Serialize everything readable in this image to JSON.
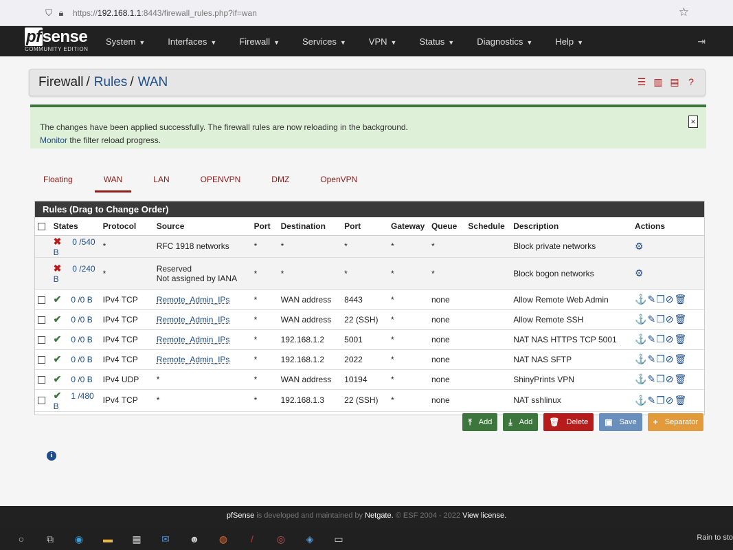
{
  "browser": {
    "url_prefix": "https://",
    "url_host": "192.168.1.1",
    "url_path": ":8443/firewall_rules.php?if=wan"
  },
  "logo": {
    "pf": "pf",
    "sense": "sense",
    "edition": "COMMUNITY EDITION"
  },
  "nav": {
    "items": [
      "System",
      "Interfaces",
      "Firewall",
      "Services",
      "VPN",
      "Status",
      "Diagnostics",
      "Help"
    ]
  },
  "title": {
    "firewall": "Firewall",
    "rules": "Rules",
    "wan": "WAN",
    "sep": "/"
  },
  "alert": {
    "message": "The changes have been applied successfully. The firewall rules are now reloading in the background.",
    "monitor": "Monitor",
    "monitor_rest": " the filter reload progress.",
    "close": "×"
  },
  "tabs": [
    "Floating",
    "WAN",
    "LAN",
    "OPENVPN",
    "DMZ",
    "OpenVPN"
  ],
  "panel": {
    "title": "Rules (Drag to Change Order)",
    "columns": [
      "",
      "States",
      "Protocol",
      "Source",
      "Port",
      "Destination",
      "Port",
      "Gateway",
      "Queue",
      "Schedule",
      "Description",
      "Actions"
    ]
  },
  "system_rules": [
    {
      "states": "0 /540 B",
      "protocol": "*",
      "source": "RFC 1918 networks",
      "source2": "",
      "port": "*",
      "destination": "*",
      "dport": "*",
      "gateway": "*",
      "queue": "*",
      "schedule": "",
      "description": "Block private networks"
    },
    {
      "states": "0 /240 B",
      "protocol": "*",
      "source": "Reserved",
      "source2": "Not assigned by IANA",
      "port": "*",
      "destination": "*",
      "dport": "*",
      "gateway": "*",
      "queue": "*",
      "schedule": "",
      "description": "Block bogon networks"
    }
  ],
  "rules": [
    {
      "states": "0 /0 B",
      "protocol": "IPv4 TCP",
      "source": "Remote_Admin_IPs",
      "port": "*",
      "destination": "WAN address",
      "dport": "8443",
      "gateway": "*",
      "queue": "none",
      "schedule": "",
      "description": "Allow Remote Web Admin"
    },
    {
      "states": "0 /0 B",
      "protocol": "IPv4 TCP",
      "source": "Remote_Admin_IPs",
      "port": "*",
      "destination": "WAN address",
      "dport": "22 (SSH)",
      "gateway": "*",
      "queue": "none",
      "schedule": "",
      "description": "Allow Remote SSH"
    },
    {
      "states": "0 /0 B",
      "protocol": "IPv4 TCP",
      "source": "Remote_Admin_IPs",
      "port": "*",
      "destination": "192.168.1.2",
      "dport": "5001",
      "gateway": "*",
      "queue": "none",
      "schedule": "",
      "description": "NAT NAS HTTPS TCP 5001"
    },
    {
      "states": "0 /0 B",
      "protocol": "IPv4 TCP",
      "source": "Remote_Admin_IPs",
      "port": "*",
      "destination": "192.168.1.2",
      "dport": "2022",
      "gateway": "*",
      "queue": "none",
      "schedule": "",
      "description": "NAT NAS SFTP"
    },
    {
      "states": "0 /0 B",
      "protocol": "IPv4 UDP",
      "source": "*",
      "port": "*",
      "destination": "WAN address",
      "dport": "10194",
      "gateway": "*",
      "queue": "none",
      "schedule": "",
      "description": "ShinyPrints VPN"
    },
    {
      "states": "1 /480 B",
      "protocol": "IPv4 TCP",
      "source": "*",
      "port": "*",
      "destination": "192.168.1.3",
      "dport": "22 (SSH)",
      "gateway": "*",
      "queue": "none",
      "schedule": "",
      "description": "NAT sshlinux"
    }
  ],
  "buttons": {
    "add_top": "Add",
    "add_bottom": "Add",
    "delete": "Delete",
    "save": "Save",
    "separator": "Separator"
  },
  "footer": {
    "brand": "pfSense",
    "middle": " is developed and maintained by ",
    "netgate": "Netgate.",
    "copy": " © ESF 2004 - 2022 ",
    "license": "View license."
  },
  "taskbar": {
    "weather": "Rain to sto"
  },
  "colors": {
    "navbar": "#212121",
    "link": "#1e4d89",
    "active_tab": "#8b1a1a",
    "pass": "#3c763d",
    "block": "#b71c1c",
    "alert_bg": "#dff0d8"
  },
  "icons": {
    "sys_action": "gear-icon",
    "rule_actions": [
      "anchor-icon",
      "pencil-icon",
      "copy-icon",
      "disable-icon",
      "trash-icon"
    ],
    "pass": "check-icon",
    "block": "x-icon"
  }
}
